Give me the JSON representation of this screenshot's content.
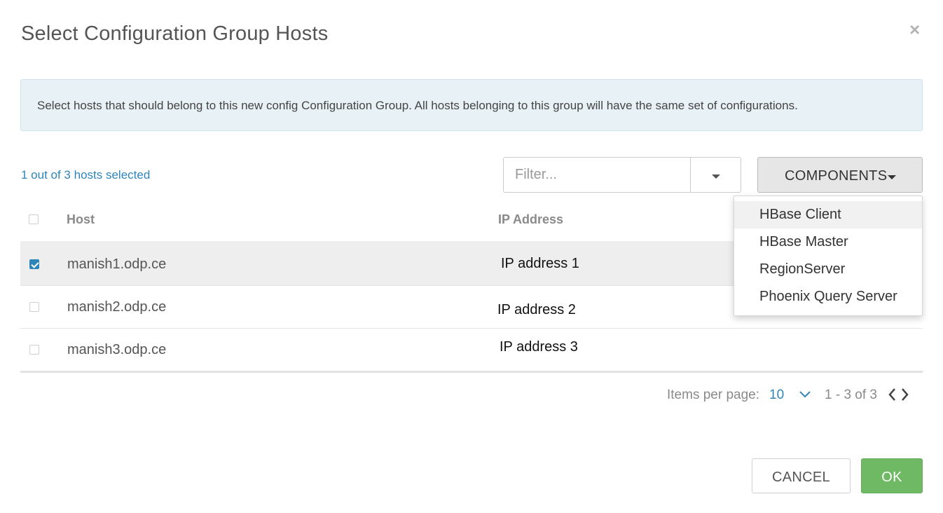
{
  "modal": {
    "title": "Select Configuration Group Hosts",
    "close_glyph": "×"
  },
  "alert": {
    "text": "Select hosts that should belong to this new config Configuration Group. All hosts belonging to this group will have the same set of configurations."
  },
  "toolbar": {
    "selected_count": "1 out of 3 hosts selected",
    "filter_placeholder": "Filter...",
    "components_label": "COMPONENTS"
  },
  "components_menu": {
    "items": [
      {
        "label": "HBase Client"
      },
      {
        "label": "HBase Master"
      },
      {
        "label": "RegionServer"
      },
      {
        "label": "Phoenix Query Server"
      }
    ]
  },
  "table": {
    "headers": {
      "host": "Host",
      "ip": "IP Address"
    },
    "rows": [
      {
        "host": "manish1.odp.ce",
        "ip": "IP address  1",
        "checked": true
      },
      {
        "host": "manish2.odp.ce",
        "ip": "IP address  2",
        "checked": false
      },
      {
        "host": "manish3.odp.ce",
        "ip": "IP address 3",
        "checked": false
      }
    ]
  },
  "pagination": {
    "items_per_page_label": "Items per page:",
    "items_per_page_value": "10",
    "range": "1 - 3 of 3"
  },
  "footer": {
    "cancel_label": "CANCEL",
    "ok_label": "OK"
  },
  "colors": {
    "accent_blue": "#2f84b8",
    "ok_green": "#6fb964",
    "alert_bg": "#e8f1f6",
    "selected_row_bg": "#eeeeee"
  },
  "icons": {
    "close": "close-icon",
    "filter_toggle": "caret-down-icon",
    "components_toggle": "caret-down-icon",
    "per_page_toggle": "chevron-down-icon",
    "prev_page": "chevron-left-icon",
    "next_page": "chevron-right-icon",
    "checked_box": "checkbox-checked-icon"
  }
}
